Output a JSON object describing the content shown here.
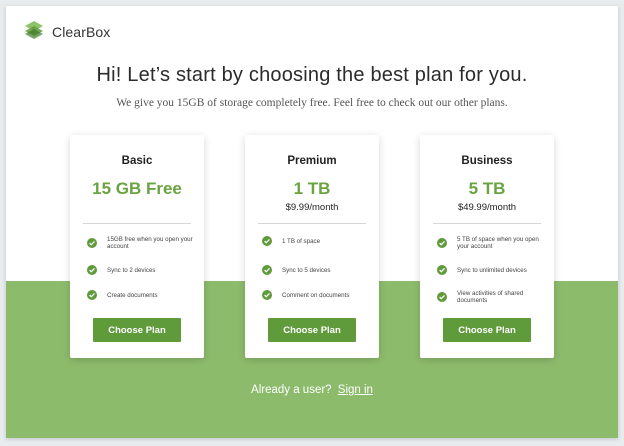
{
  "brand": {
    "name": "ClearBox",
    "logo_icon": "stacked-diamond-logo-icon"
  },
  "hero": {
    "headline": "Hi! Let’s start by choosing the best plan for you.",
    "subline": "We give you 15GB of storage completely free. Feel free to check out our other plans."
  },
  "plans": [
    {
      "name": "Basic",
      "size": "15 GB Free",
      "price": "",
      "features": [
        "15GB free when you open your account",
        "Sync to 2 devices",
        "Create documents"
      ],
      "button": "Choose Plan"
    },
    {
      "name": "Premium",
      "size": "1 TB",
      "price": "$9.99/month",
      "features": [
        "1 TB of space",
        "Sync to 5 devices",
        "Comment on documents"
      ],
      "button": "Choose Plan"
    },
    {
      "name": "Business",
      "size": "5 TB",
      "price": "$49.99/month",
      "features": [
        "5 TB of space when you open your account",
        "Sync to unlimited devices",
        "View activities of shared documents"
      ],
      "button": "Choose Plan"
    }
  ],
  "footer": {
    "prompt": "Already a user?",
    "signin_label": "Sign in"
  },
  "colors": {
    "accent": "#6aa341",
    "button": "#5f9a3b",
    "band": "#8dbb6c",
    "check": "#5f9a3b"
  },
  "icons": {
    "feature": "check-circle-icon"
  }
}
